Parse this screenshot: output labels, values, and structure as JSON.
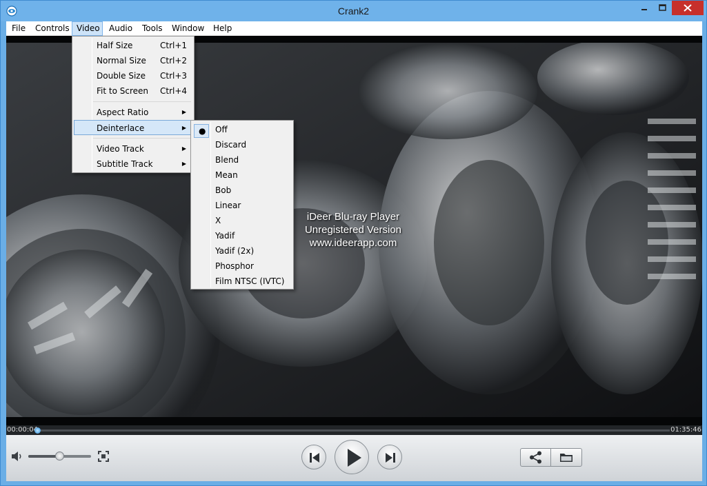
{
  "window": {
    "title": "Crank2",
    "colors": {
      "frame": "#6fb2ea",
      "close": "#c7302b",
      "menu_highlight": "#d5e7f8"
    }
  },
  "menubar": {
    "items": [
      {
        "label": "File"
      },
      {
        "label": "Controls"
      },
      {
        "label": "Video"
      },
      {
        "label": "Audio"
      },
      {
        "label": "Tools"
      },
      {
        "label": "Window"
      },
      {
        "label": "Help"
      }
    ],
    "active": "Video"
  },
  "video_menu": {
    "items": [
      {
        "label": "Half Size",
        "shortcut": "Ctrl+1"
      },
      {
        "label": "Normal Size",
        "shortcut": "Ctrl+2"
      },
      {
        "label": "Double Size",
        "shortcut": "Ctrl+3"
      },
      {
        "label": "Fit to Screen",
        "shortcut": "Ctrl+4"
      },
      {
        "label": "Aspect Ratio",
        "submenu": true
      },
      {
        "label": "Deinterlace",
        "submenu": true,
        "highlighted": true
      },
      {
        "label": "Video Track",
        "submenu": true
      },
      {
        "label": "Subtitle Track",
        "submenu": true
      }
    ]
  },
  "deinterlace_menu": {
    "selected": "Off",
    "check_glyph": "●",
    "items": [
      {
        "label": "Off"
      },
      {
        "label": "Discard"
      },
      {
        "label": "Blend"
      },
      {
        "label": "Mean"
      },
      {
        "label": "Bob"
      },
      {
        "label": "Linear"
      },
      {
        "label": "X"
      },
      {
        "label": "Yadif"
      },
      {
        "label": "Yadif (2x)"
      },
      {
        "label": "Phosphor"
      },
      {
        "label": "Film NTSC (IVTC)"
      }
    ]
  },
  "video": {
    "watermark_lines": [
      "iDeer Blu-ray Player",
      "Unregistered Version",
      "www.ideerapp.com"
    ]
  },
  "playback": {
    "elapsed": "00:00:04",
    "total": "01:35:46",
    "progress_fraction": 0.0007,
    "volume_fraction": 0.5
  },
  "controls": {
    "icons": [
      "volume-icon",
      "fullscreen-icon",
      "previous-icon",
      "play-icon",
      "next-icon",
      "share-icon",
      "folder-icon"
    ]
  }
}
